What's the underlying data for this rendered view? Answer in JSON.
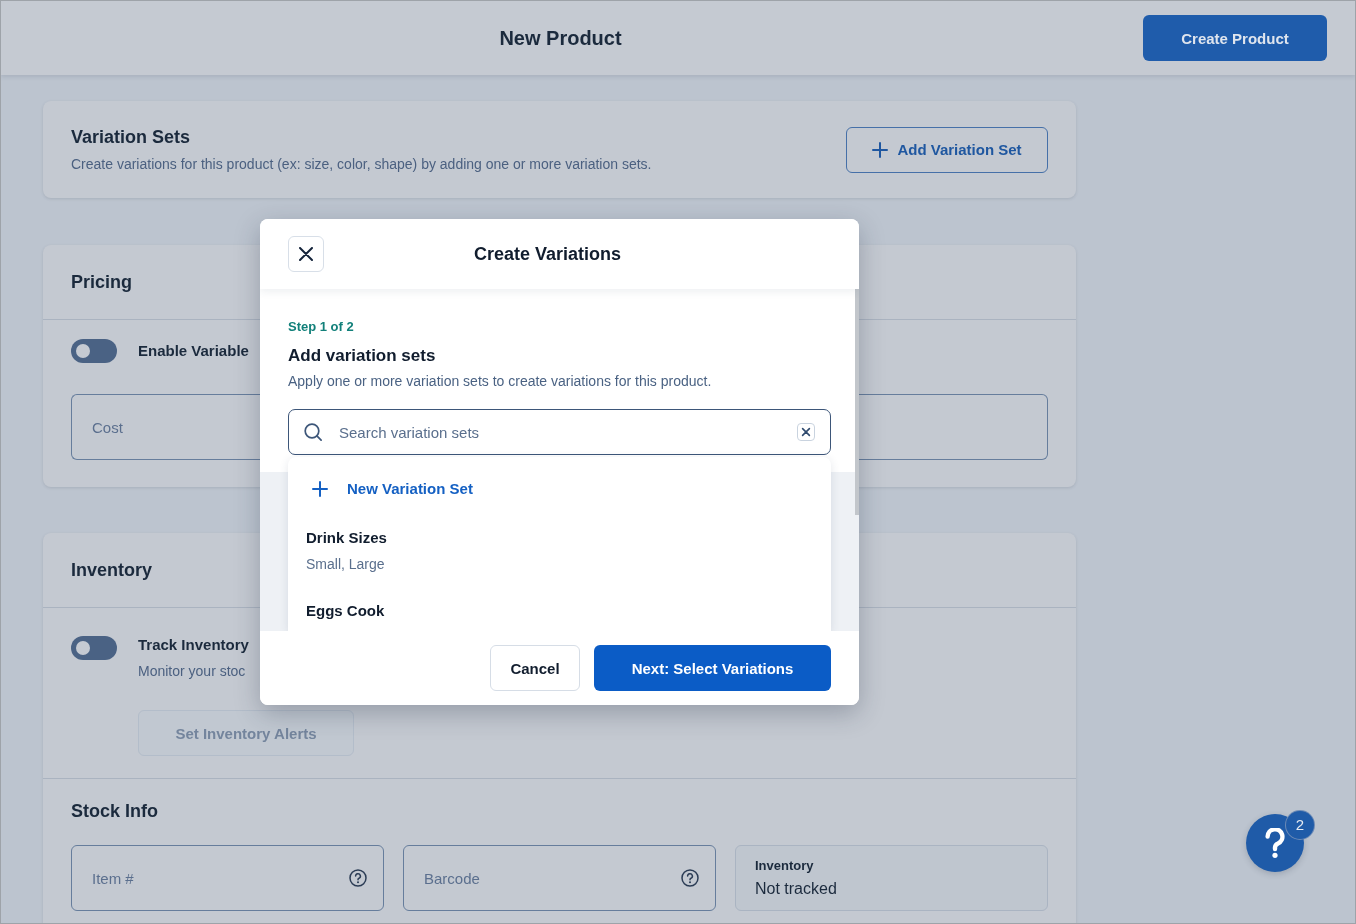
{
  "header": {
    "title": "New Product",
    "create_button": "Create Product"
  },
  "variation_sets": {
    "title": "Variation Sets",
    "description": "Create variations for this product (ex: size, color, shape) by adding one or more variation sets.",
    "add_button": "Add Variation Set"
  },
  "pricing": {
    "title": "Pricing",
    "toggle": {
      "label": "Enable Variable",
      "on": false
    },
    "cost_field": {
      "placeholder": "Cost"
    }
  },
  "inventory": {
    "title": "Inventory",
    "toggle": {
      "label": "Track Inventory",
      "description": "Monitor your stoc",
      "on": false
    },
    "alerts_button": {
      "label": "Set Inventory Alerts",
      "disabled": true
    }
  },
  "stock_info": {
    "title": "Stock Info",
    "fields": [
      {
        "kind": "input",
        "placeholder": "Item #"
      },
      {
        "kind": "input",
        "placeholder": "Barcode"
      },
      {
        "kind": "readonly",
        "label": "Inventory",
        "value": "Not tracked"
      }
    ]
  },
  "modal": {
    "title": "Create Variations",
    "step": "Step 1 of 2",
    "heading": "Add variation sets",
    "description": "Apply one or more variation sets to create variations for this product.",
    "search": {
      "placeholder": "Search variation sets"
    },
    "options": [
      {
        "kind": "create",
        "label": "New Variation Set"
      },
      {
        "kind": "set",
        "name": "Drink Sizes",
        "values": "Small, Large"
      },
      {
        "kind": "set",
        "name": "Eggs Cook"
      }
    ],
    "buttons": [
      {
        "kind": "secondary",
        "label": "Cancel"
      },
      {
        "kind": "primary",
        "label": "Next: Select Variations"
      }
    ]
  },
  "help": {
    "badge": "2"
  }
}
